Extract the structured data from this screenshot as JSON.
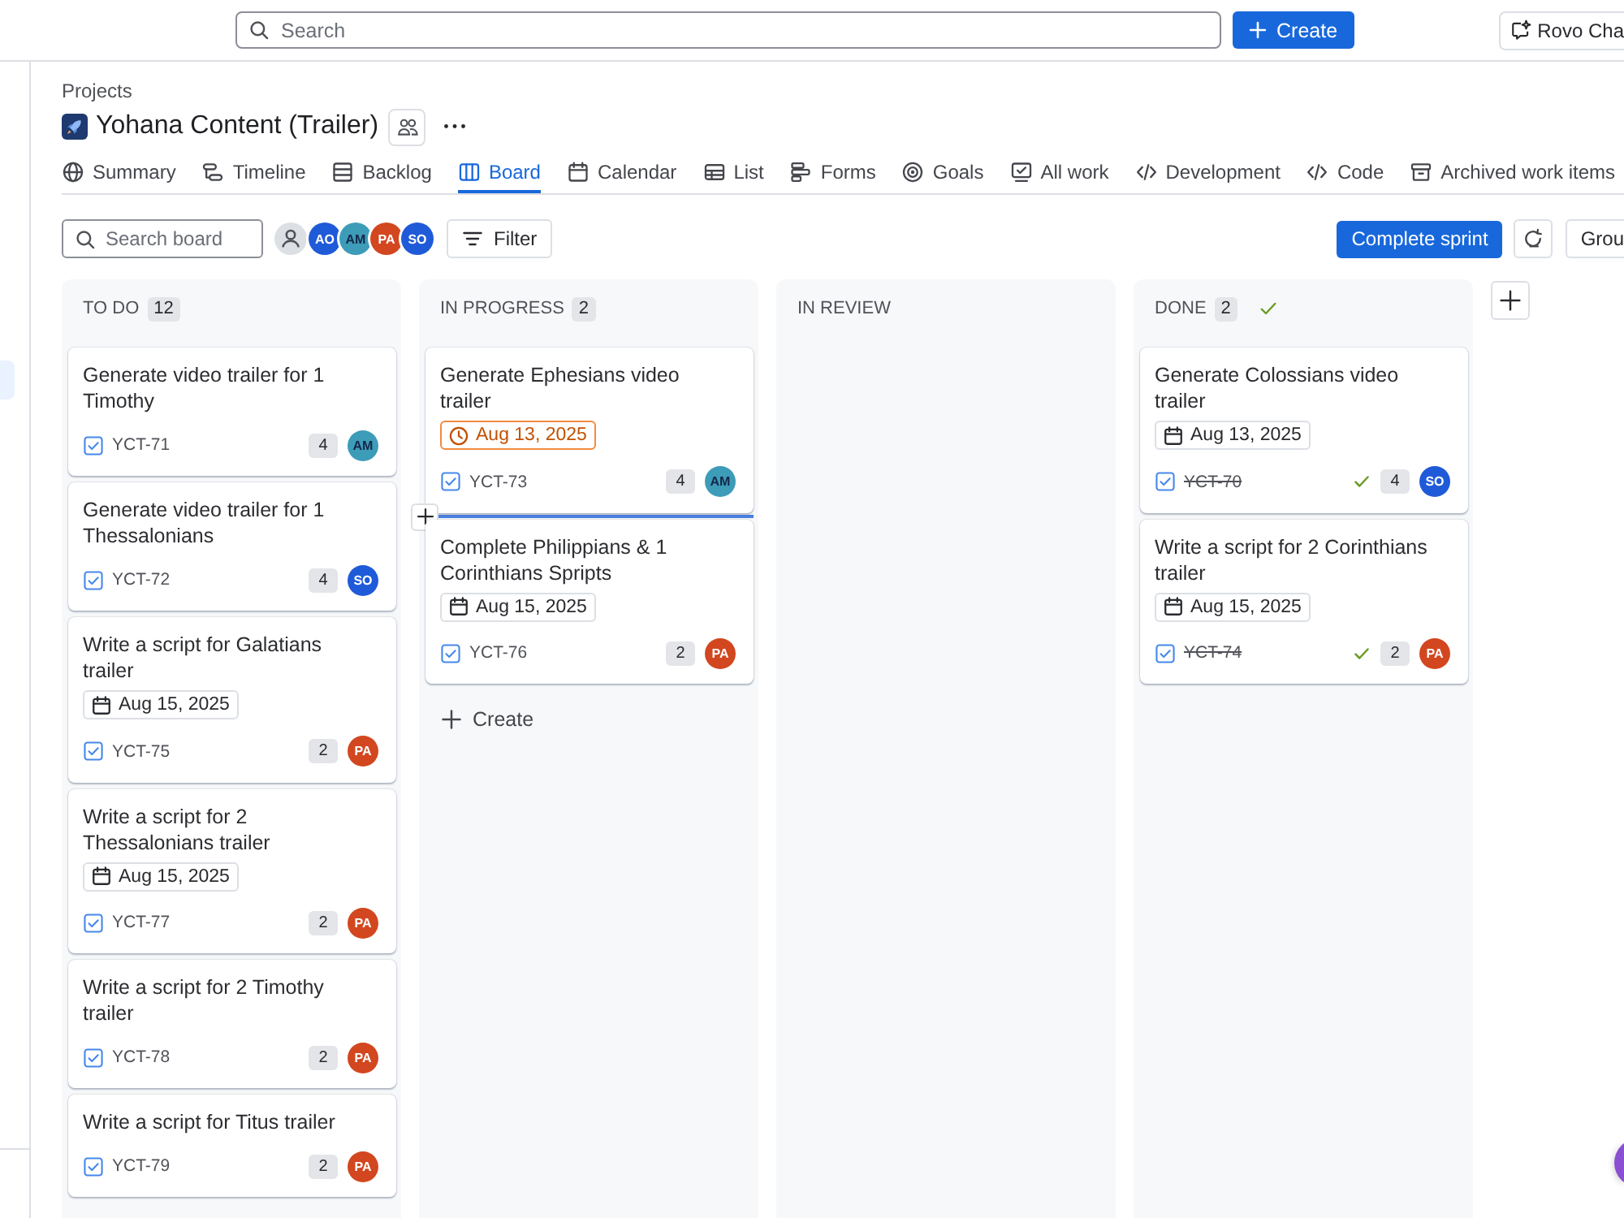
{
  "top_bar": {
    "search": {
      "placeholder": "Search"
    },
    "create_button": "Create",
    "chat_button": "Rovo Cha"
  },
  "breadcrumb": "Projects",
  "project_title": "Yohana Content (Trailer)",
  "tabs": [
    {
      "label": "Summary",
      "selected": false
    },
    {
      "label": "Timeline",
      "selected": false
    },
    {
      "label": "Backlog",
      "selected": false
    },
    {
      "label": "Board",
      "selected": true
    },
    {
      "label": "Calendar",
      "selected": false
    },
    {
      "label": "List",
      "selected": false
    },
    {
      "label": "Forms",
      "selected": false
    },
    {
      "label": "Goals",
      "selected": false
    },
    {
      "label": "All work",
      "selected": false
    },
    {
      "label": "Development",
      "selected": false
    },
    {
      "label": "Code",
      "selected": false
    },
    {
      "label": "Archived work items",
      "selected": false
    }
  ],
  "toolbar": {
    "search": {
      "placeholder": "Search board"
    },
    "avatars": [
      {
        "kind": "unassigned"
      },
      {
        "kind": "initials",
        "initials": "AO",
        "color": "#1f5ad8"
      },
      {
        "kind": "initials",
        "initials": "AM",
        "color": "#3d9cb8"
      },
      {
        "kind": "initials",
        "initials": "PA",
        "color": "#d2471f"
      },
      {
        "kind": "initials",
        "initials": "SO",
        "color": "#1f5ad8"
      }
    ],
    "filter_button": "Filter",
    "complete_button": "Complete sprint",
    "group_button": "Grou"
  },
  "columns": [
    {
      "title": "TO DO",
      "count": "12",
      "complete": false,
      "cards": [
        {
          "title": "Generate video trailer for 1 Timothy",
          "key": "YCT-71",
          "points": "4",
          "assignee": {
            "initials": "AM",
            "color": "#3d9cb8"
          },
          "done": false,
          "insert_marker": false
        },
        {
          "title": "Generate video trailer for 1 Thessalonians",
          "key": "YCT-72",
          "points": "4",
          "assignee": {
            "initials": "SO",
            "color": "#1f5ad8"
          },
          "done": false,
          "insert_marker": false
        },
        {
          "title": "Write a script for Galatians trailer",
          "due": {
            "date": "Aug 15, 2025",
            "overdue": false
          },
          "key": "YCT-75",
          "points": "2",
          "assignee": {
            "initials": "PA",
            "color": "#d2471f"
          },
          "done": false,
          "insert_marker": false
        },
        {
          "title": "Write a script for 2 Thessalonians trailer",
          "due": {
            "date": "Aug 15, 2025",
            "overdue": false
          },
          "key": "YCT-77",
          "points": "2",
          "assignee": {
            "initials": "PA",
            "color": "#d2471f"
          },
          "done": false,
          "insert_marker": false
        },
        {
          "title": "Write a script for 2 Timothy trailer",
          "key": "YCT-78",
          "points": "2",
          "assignee": {
            "initials": "PA",
            "color": "#d2471f"
          },
          "done": false,
          "insert_marker": false
        },
        {
          "title": "Write a script for Titus trailer",
          "key": "YCT-79",
          "points": "2",
          "assignee": {
            "initials": "PA",
            "color": "#d2471f"
          },
          "done": false,
          "insert_marker": false
        }
      ]
    },
    {
      "title": "IN PROGRESS",
      "count": "2",
      "complete": false,
      "cards": [
        {
          "title": "Generate Ephesians video trailer",
          "due": {
            "date": "Aug 13, 2025",
            "overdue": true
          },
          "key": "YCT-73",
          "points": "4",
          "assignee": {
            "initials": "AM",
            "color": "#3d9cb8"
          },
          "done": false,
          "insert_marker": true
        },
        {
          "title": "Complete Philippians & 1 Corinthians Spripts",
          "due": {
            "date": "Aug 15, 2025",
            "overdue": false
          },
          "key": "YCT-76",
          "points": "2",
          "assignee": {
            "initials": "PA",
            "color": "#d2471f"
          },
          "done": false,
          "insert_marker": false
        }
      ],
      "create_label": "Create"
    },
    {
      "title": "IN REVIEW",
      "complete": false
    },
    {
      "title": "DONE",
      "count": "2",
      "complete": true,
      "cards": [
        {
          "title": "Generate Colossians video trailer",
          "due": {
            "date": "Aug 13, 2025",
            "overdue": false
          },
          "key": "YCT-70",
          "points": "4",
          "assignee": {
            "initials": "SO",
            "color": "#1f5ad8"
          },
          "done": true,
          "insert_marker": false
        },
        {
          "title": "Write a script for 2 Corinthians trailer",
          "due": {
            "date": "Aug 15, 2025",
            "overdue": false
          },
          "key": "YCT-74",
          "points": "2",
          "assignee": {
            "initials": "PA",
            "color": "#d2471f"
          },
          "done": true,
          "insert_marker": false
        }
      ]
    }
  ]
}
